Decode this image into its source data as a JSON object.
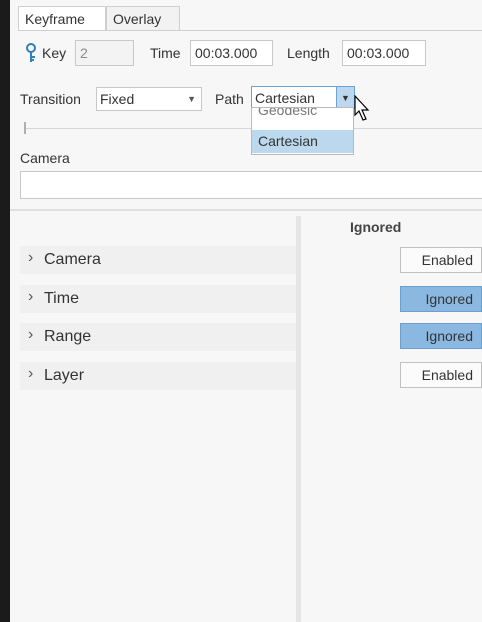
{
  "tabs": [
    {
      "label": "Keyframe",
      "active": true
    },
    {
      "label": "Overlay",
      "active": false
    }
  ],
  "key": {
    "label": "Key",
    "value": "2",
    "icon": "key-icon"
  },
  "time": {
    "label": "Time",
    "value": "00:03.000"
  },
  "length": {
    "label": "Length",
    "value": "00:03.000"
  },
  "transition": {
    "label": "Transition",
    "value": "Fixed"
  },
  "path": {
    "label": "Path",
    "value": "Cartesian",
    "options": [
      "Geodesic",
      "Cartesian"
    ],
    "selected_index": 1
  },
  "camera_section": {
    "label": "Camera",
    "value": ""
  },
  "grid": {
    "header": "Ignored",
    "rows": [
      {
        "label": "Camera",
        "state": "Enabled"
      },
      {
        "label": "Time",
        "state": "Ignored"
      },
      {
        "label": "Range",
        "state": "Ignored"
      },
      {
        "label": "Layer",
        "state": "Enabled"
      }
    ]
  },
  "colors": {
    "accent": "#8ab8e0",
    "selection": "#bcd8ef"
  }
}
